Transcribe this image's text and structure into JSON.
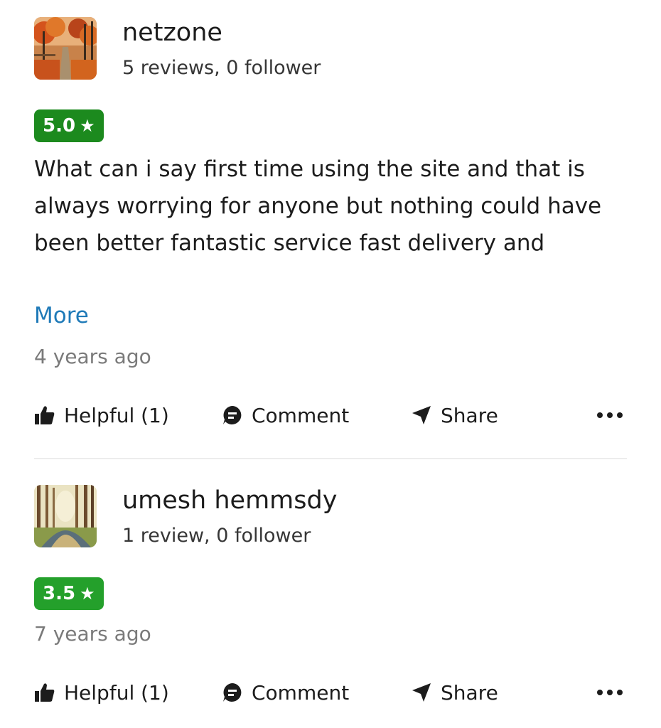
{
  "reviews": [
    {
      "user_name": "netzone",
      "user_stats": "5 reviews, 0 follower",
      "rating": "5.0",
      "rating_color": "#1c8a1e",
      "text": "What can i say first time using the site and that is always worrying for anyone but nothing could have been better fantastic service fast delivery and",
      "more_label": "More",
      "timestamp": "4 years ago",
      "actions": {
        "helpful": "Helpful (1)",
        "comment": "Comment",
        "share": "Share"
      }
    },
    {
      "user_name": "umesh hemmsdy",
      "user_stats": "1 review, 0 follower",
      "rating": "3.5",
      "rating_color": "#24a02b",
      "timestamp": "7 years ago",
      "actions": {
        "helpful": "Helpful (1)",
        "comment": "Comment",
        "share": "Share"
      }
    }
  ],
  "icons": {
    "star": "star-icon",
    "helpful": "thumbs-up-icon",
    "comment": "comment-icon",
    "share": "share-arrow-icon",
    "more": "more-options-icon"
  },
  "colors": {
    "link": "#1f7ab8",
    "timestamp": "#7a7a7a",
    "text": "#1c1c1c"
  }
}
